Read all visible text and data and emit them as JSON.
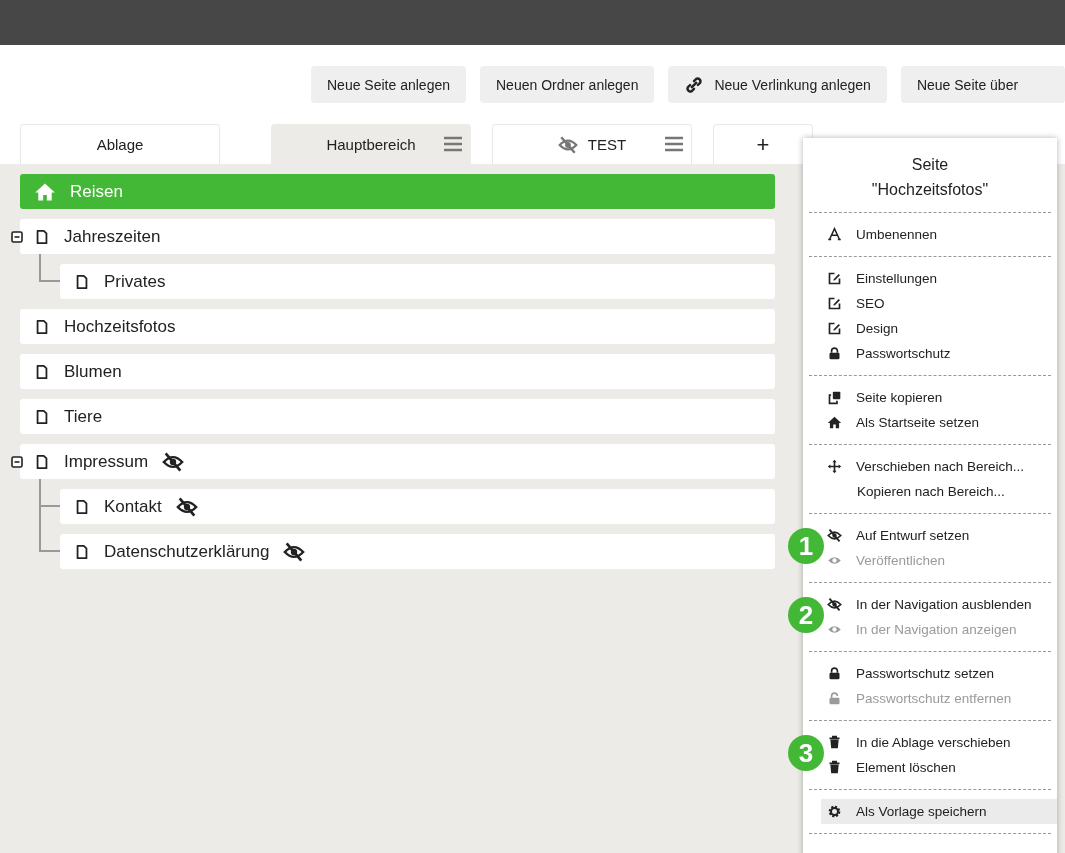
{
  "toolbar": [
    {
      "label": "Neue Seite anlegen",
      "kind": "plain"
    },
    {
      "label": "Neuen Ordner anlegen",
      "kind": "plain"
    },
    {
      "label": "Neue Verlinkung anlegen",
      "kind": "link"
    },
    {
      "label": "Neue Seite über",
      "kind": "plain"
    }
  ],
  "tabs": [
    {
      "kind": "area",
      "label": "Ablage",
      "selected": false,
      "hidden": false,
      "menu": false
    },
    {
      "kind": "area",
      "label": "Hauptbereich",
      "selected": true,
      "hidden": false,
      "menu": true
    },
    {
      "kind": "area",
      "label": "TEST",
      "selected": false,
      "hidden": true,
      "menu": true
    },
    {
      "kind": "add",
      "label": "+",
      "selected": false,
      "hidden": false,
      "menu": false
    }
  ],
  "tree": [
    {
      "kind": "home",
      "label": "Reisen",
      "selected": true,
      "hidden": false
    },
    {
      "kind": "page",
      "label": "Jahreszeiten",
      "selected": false,
      "hidden": false,
      "expanded": true,
      "children": [
        {
          "kind": "page",
          "label": "Privates",
          "selected": false,
          "hidden": false
        }
      ]
    },
    {
      "kind": "page",
      "label": "Hochzeitsfotos",
      "selected": false,
      "hidden": false
    },
    {
      "kind": "page",
      "label": "Blumen",
      "selected": false,
      "hidden": false
    },
    {
      "kind": "page",
      "label": "Tiere",
      "selected": false,
      "hidden": false
    },
    {
      "kind": "page",
      "label": "Impressum",
      "selected": false,
      "hidden": true,
      "expanded": true,
      "children": [
        {
          "kind": "page",
          "label": "Kontakt",
          "selected": false,
          "hidden": true
        },
        {
          "kind": "page",
          "label": "Datenschutzerklärung",
          "selected": false,
          "hidden": true
        }
      ]
    }
  ],
  "context_menu": {
    "title": [
      "Seite",
      "\"Hochzeitsfotos\""
    ],
    "sections": [
      {
        "items": [
          {
            "kind": "rename",
            "label": "Umbenennen",
            "disabled": false,
            "selected": false
          }
        ]
      },
      {
        "items": [
          {
            "kind": "edit",
            "label": "Einstellungen",
            "disabled": false,
            "selected": false
          },
          {
            "kind": "edit",
            "label": "SEO",
            "disabled": false,
            "selected": false
          },
          {
            "kind": "edit",
            "label": "Design",
            "disabled": false,
            "selected": false
          },
          {
            "kind": "lock",
            "label": "Passwortschutz",
            "disabled": false,
            "selected": false
          }
        ]
      },
      {
        "items": [
          {
            "kind": "copy",
            "label": "Seite kopieren",
            "disabled": false,
            "selected": false
          },
          {
            "kind": "home",
            "label": "Als Startseite setzen",
            "disabled": false,
            "selected": false
          }
        ]
      },
      {
        "items": [
          {
            "kind": "move",
            "label": "Verschieben nach Bereich...",
            "disabled": false,
            "selected": false
          },
          {
            "kind": "plain",
            "label": "Kopieren nach Bereich...",
            "disabled": false,
            "selected": false
          }
        ]
      },
      {
        "badge": "1",
        "items": [
          {
            "kind": "hide",
            "label": "Auf Entwurf setzen",
            "disabled": false,
            "selected": false
          },
          {
            "kind": "show",
            "label": "Veröffentlichen",
            "disabled": true,
            "selected": false
          }
        ]
      },
      {
        "badge": "2",
        "items": [
          {
            "kind": "hide",
            "label": "In der Navigation ausblenden",
            "disabled": false,
            "selected": false
          },
          {
            "kind": "show",
            "label": "In der Navigation anzeigen",
            "disabled": true,
            "selected": false
          }
        ]
      },
      {
        "items": [
          {
            "kind": "lock",
            "label": "Passwortschutz setzen",
            "disabled": false,
            "selected": false
          },
          {
            "kind": "unlock",
            "label": "Passwortschutz entfernen",
            "disabled": true,
            "selected": false
          }
        ]
      },
      {
        "badge": "3",
        "items": [
          {
            "kind": "trash",
            "label": "In die Ablage verschieben",
            "disabled": false,
            "selected": false
          },
          {
            "kind": "trash",
            "label": "Element löschen",
            "disabled": false,
            "selected": false
          }
        ]
      },
      {
        "items": [
          {
            "kind": "template",
            "label": "Als Vorlage speichern",
            "disabled": false,
            "selected": true
          }
        ]
      }
    ]
  }
}
